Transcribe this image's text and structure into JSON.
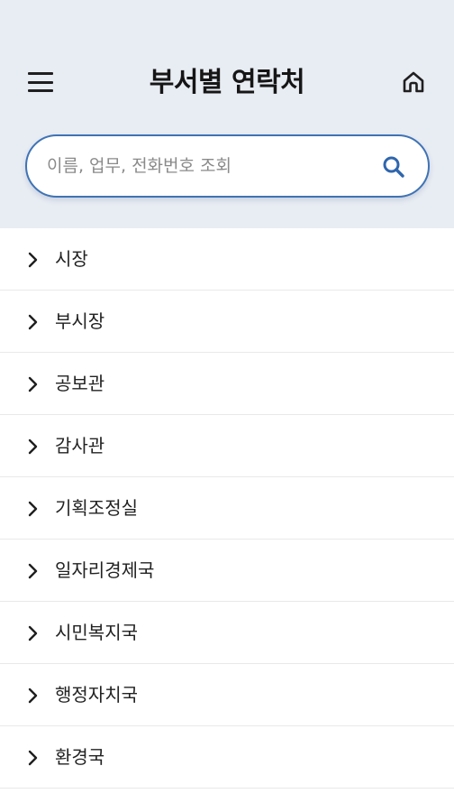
{
  "header": {
    "title": "부서별 연락처",
    "menu_icon": "hamburger-menu-icon",
    "home_icon": "home-icon",
    "background": "#e8ecf3"
  },
  "search": {
    "placeholder": "이름, 업무, 전화번호 조회",
    "value": "",
    "icon": "search-icon",
    "accent": "#3f73b5"
  },
  "departments": [
    {
      "label": "시장"
    },
    {
      "label": "부시장"
    },
    {
      "label": "공보관"
    },
    {
      "label": "감사관"
    },
    {
      "label": "기획조정실"
    },
    {
      "label": "일자리경제국"
    },
    {
      "label": "시민복지국"
    },
    {
      "label": "행정자치국"
    },
    {
      "label": "환경국"
    }
  ]
}
